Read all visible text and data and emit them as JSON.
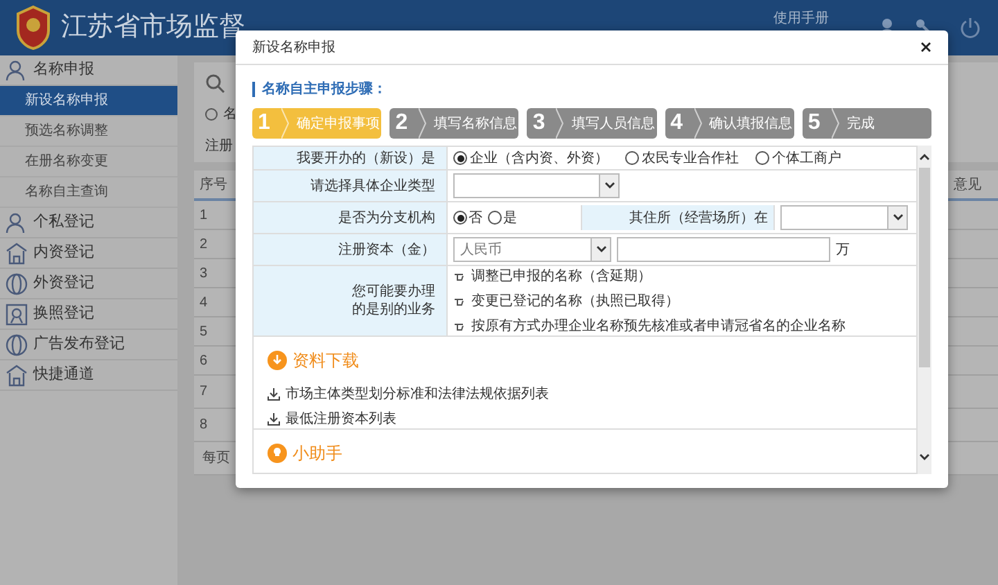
{
  "header": {
    "title": "江苏省市场监督",
    "manual": "使用手册"
  },
  "sidebar": {
    "groups": [
      {
        "label": "名称申报",
        "kind": "person",
        "children": [
          {
            "label": "新设名称申报",
            "selected": true
          },
          {
            "label": "预选名称调整",
            "selected": false
          },
          {
            "label": "在册名称变更",
            "selected": false
          },
          {
            "label": "名称自主查询",
            "selected": false
          }
        ]
      },
      {
        "label": "个私登记",
        "kind": "person"
      },
      {
        "label": "内资登记",
        "kind": "building"
      },
      {
        "label": "外资登记",
        "kind": "globe"
      },
      {
        "label": "换照登记",
        "kind": "badge"
      },
      {
        "label": "广告发布登记",
        "kind": "globe"
      },
      {
        "label": "快捷通道",
        "kind": "building"
      }
    ]
  },
  "background": {
    "radio_label": "名",
    "radio_selected": false,
    "field_label": "注册",
    "columns": [
      "序号",
      "意见"
    ],
    "rows": [
      "1",
      "2",
      "3",
      "4",
      "5",
      "6",
      "7",
      "8"
    ],
    "footer": "每页"
  },
  "dialog": {
    "title": "新设名称申报",
    "steps_heading": "名称自主申报步骤：",
    "steps": [
      {
        "number": "1",
        "label": "确定申报事项",
        "selected": true
      },
      {
        "number": "2",
        "label": "填写名称信息",
        "selected": false
      },
      {
        "number": "3",
        "label": "填写人员信息",
        "selected": false
      },
      {
        "number": "4",
        "label": "确认填报信息",
        "selected": false
      },
      {
        "number": "5",
        "label": "完成",
        "selected": false
      }
    ],
    "form": [
      {
        "kind": "radio",
        "label": "我要开办的（新设）是",
        "options": [
          {
            "label": "企业（含内资、外资）",
            "selected": true
          },
          {
            "label": "农民专业合作社",
            "selected": false
          },
          {
            "label": "个体工商户",
            "selected": false
          }
        ]
      },
      {
        "kind": "select",
        "label": "请选择具体企业类型"
      },
      {
        "kind": "branch",
        "label": "是否为分支机构",
        "options": [
          {
            "label": "否",
            "selected": true
          },
          {
            "label": "是",
            "selected": false
          }
        ],
        "second_label": "其住所（经营场所）在"
      },
      {
        "kind": "money",
        "label": "注册资本（金）",
        "currency": "人民币",
        "unit": "万"
      },
      {
        "kind": "links",
        "label": "您可能要办理的是别的业务",
        "options": [
          "调整已申报的名称（含延期）",
          "变更已登记的名称（执照已取得）",
          "按原有方式办理企业名称预先核准或者申请冠省名的企业名称"
        ]
      }
    ],
    "downloads": {
      "title": "资料下载",
      "items": [
        "市场主体类型划分标准和法律法规依据列表",
        "最低注册资本列表"
      ]
    },
    "helper": {
      "title": "小助手"
    }
  }
}
